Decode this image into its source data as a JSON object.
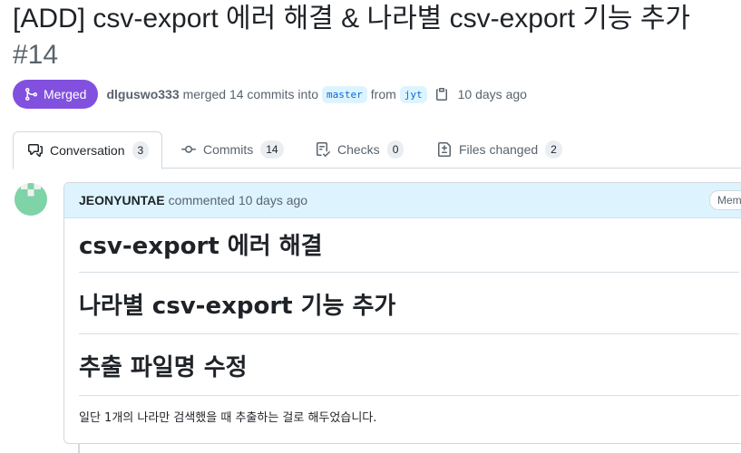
{
  "pr": {
    "title": "[ADD] csv-export 에러 해결 & 나라별 csv-export 기능 추가",
    "number": "#14",
    "state": "Merged",
    "author": "dlguswo333",
    "merge_text": "merged 14 commits into",
    "base_branch": "master",
    "from_text": "from",
    "head_branch": "jyt",
    "time": "10 days ago"
  },
  "tabs": [
    {
      "label": "Conversation",
      "count": "3",
      "icon": "comment-discussion-icon"
    },
    {
      "label": "Commits",
      "count": "14",
      "icon": "commit-icon"
    },
    {
      "label": "Checks",
      "count": "0",
      "icon": "checklist-icon"
    },
    {
      "label": "Files changed",
      "count": "2",
      "icon": "file-diff-icon"
    }
  ],
  "comment": {
    "author": "JEONYUNTAE",
    "action": "commented",
    "time": "10 days ago",
    "role": "Member",
    "headings": [
      "csv-export 에러 해결",
      "나라별 csv-export 기능 추가",
      "추출 파일명 수정"
    ],
    "note": "일단 1개의 나라만 검색했을 때 추출하는 걸로 해두었습니다."
  },
  "colors": {
    "merged": "#8250df",
    "branch_bg": "#ddf4ff",
    "branch_text": "#0969da",
    "header_bg": "#ddf4ff",
    "avatar": "#7ed3a7"
  }
}
